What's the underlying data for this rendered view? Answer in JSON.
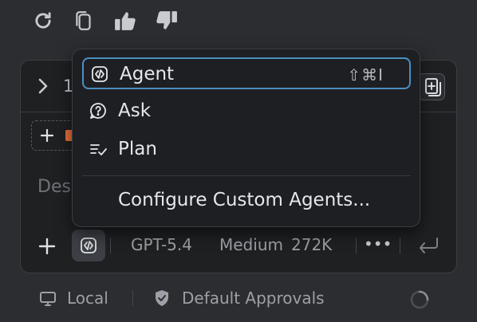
{
  "feedback_bar": {
    "icons": [
      "refresh-icon",
      "copy-icon",
      "thumbs-up-icon",
      "thumbs-down-icon"
    ]
  },
  "chat_panel": {
    "header": {
      "count": "1"
    },
    "placeholder": "Des",
    "toolbar": {
      "model": "GPT-5.4",
      "reasoning": "Medium",
      "context": "272K",
      "more": "•••"
    }
  },
  "status_bar": {
    "environment": "Local",
    "approvals": "Default Approvals"
  },
  "mode_menu": {
    "items": [
      {
        "label": "Agent",
        "shortcut": "⇧⌘I",
        "icon": "agent-icon",
        "selected": true
      },
      {
        "label": "Ask",
        "shortcut": "",
        "icon": "ask-question-icon",
        "selected": false
      },
      {
        "label": "Plan",
        "shortcut": "",
        "icon": "plan-checklist-icon",
        "selected": false
      }
    ],
    "configure_label": "Configure Custom Agents..."
  },
  "colors": {
    "background": "#2b2d30",
    "panel": "#1f2022",
    "menu": "#1e1f22",
    "selection_border": "#4a8fbf",
    "html_badge": "#e8703a"
  }
}
